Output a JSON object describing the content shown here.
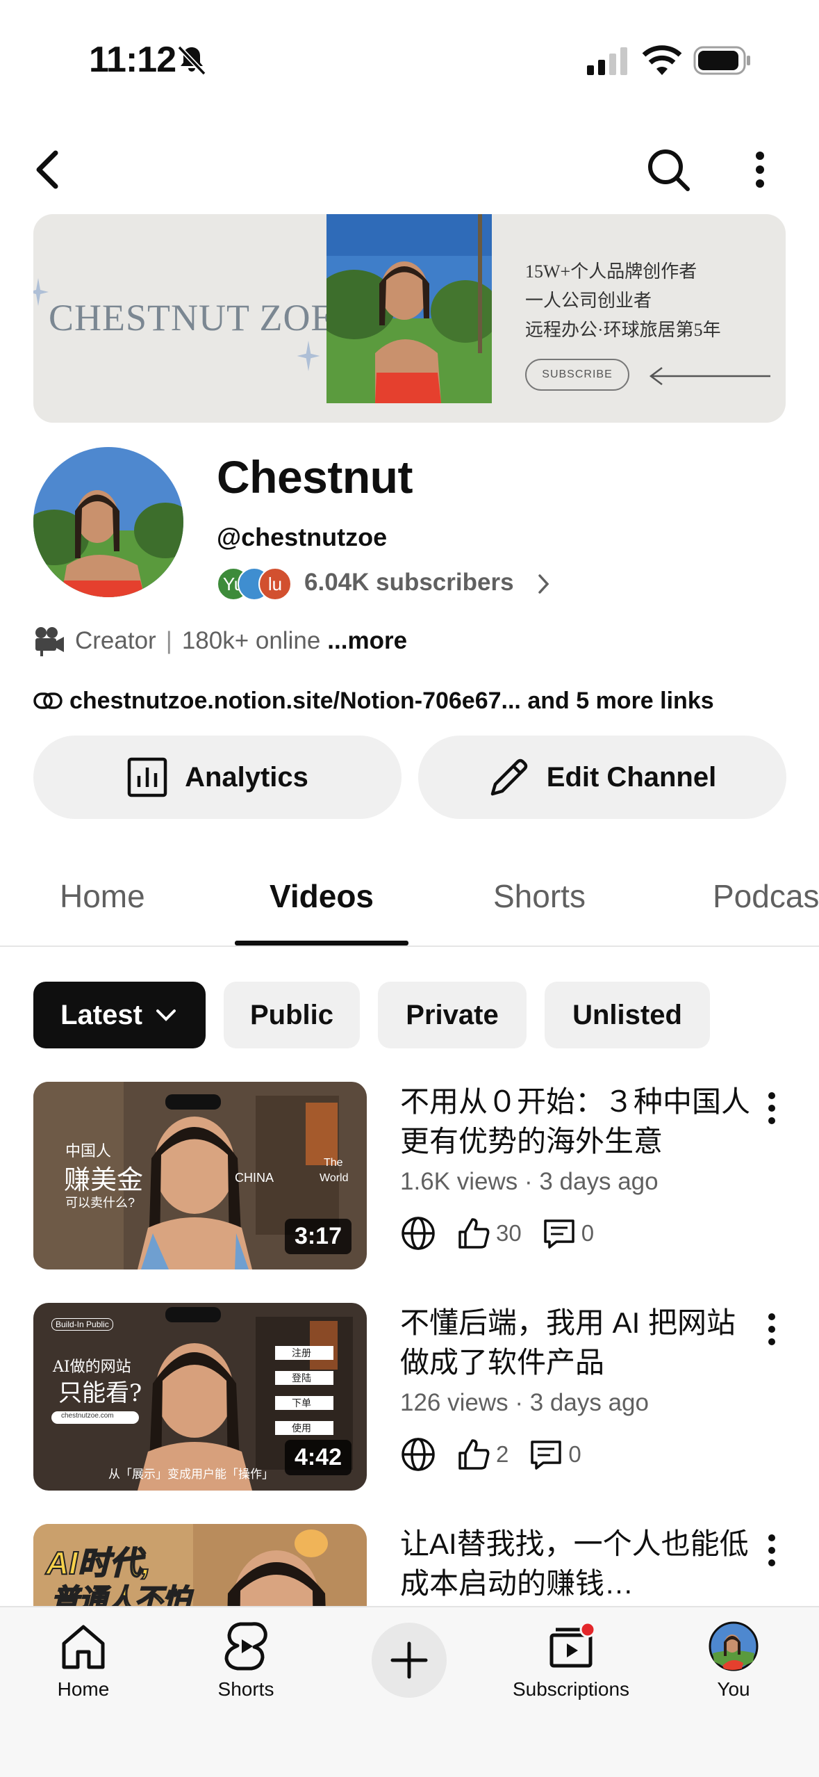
{
  "status": {
    "time": "11:12"
  },
  "banner": {
    "name": "CHESTNUT ZOE",
    "lines": [
      "15W+个人品牌创作者",
      "一人公司创业者",
      "远程办公·环球旅居第5年"
    ],
    "subscribe": "SUBSCRIBE"
  },
  "channel": {
    "name": "Chestnut",
    "handle": "@chestnutzoe",
    "subscriber_avatars": [
      "Yu",
      "",
      "lu"
    ],
    "subscribers": "6.04K subscribers",
    "category": "Creator",
    "online": "180k+ online",
    "more": "...more",
    "link": "chestnutzoe.notion.site/Notion-706e67...",
    "more_links": " and 5 more links"
  },
  "actions": {
    "analytics": "Analytics",
    "edit": "Edit Channel"
  },
  "tabs": [
    "Home",
    "Videos",
    "Shorts",
    "Podcas"
  ],
  "chips": [
    "Latest",
    "Public",
    "Private",
    "Unlisted"
  ],
  "videos": [
    {
      "title": "不用从０开始：３种中国人更有优势的海外生意",
      "meta": "1.6K views · 3 days ago",
      "likes": "30",
      "comments": "0",
      "duration": "3:17",
      "thumb_text": [
        "中国人",
        "赚美金",
        "可以卖什么?",
        "CHINA",
        "The",
        "World"
      ]
    },
    {
      "title": "不懂后端，我用 AI 把网站做成了软件产品",
      "meta": "126 views · 3 days ago",
      "likes": "2",
      "comments": "0",
      "duration": "4:42",
      "thumb_text": [
        "Build-In Public",
        "AI做的网站",
        "只能看?",
        "注册",
        "登陆",
        "下单",
        "使用",
        "从「展示」变成用户能「操作」",
        "chestnutzoe.com"
      ]
    },
    {
      "title": "让AI替我找，一个人也能低成本启动的赚钱…",
      "thumb_text": [
        "AI时代,",
        "普通人不怕"
      ]
    }
  ],
  "nav": [
    "Home",
    "Shorts",
    "Subscriptions",
    "You"
  ],
  "colors": {
    "accent": "#0f0f0f",
    "secondary_text": "#606060",
    "chip_bg": "#f0f0f0",
    "notification": "#e3262a"
  }
}
